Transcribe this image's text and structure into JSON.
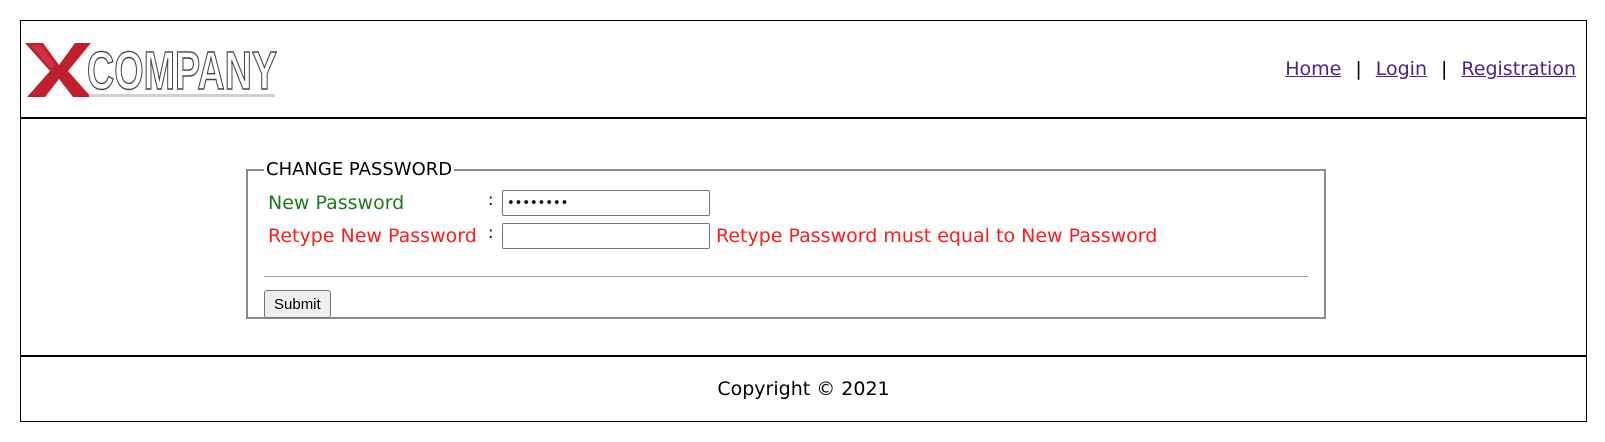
{
  "header": {
    "logo_letter": "X",
    "logo_text": "COMPANY",
    "nav": {
      "home": "Home",
      "separator1": "|",
      "login": "Login",
      "separator2": "|",
      "registration": "Registration"
    }
  },
  "form": {
    "legend": "CHANGE PASSWORD",
    "new_password": {
      "label": "New Password",
      "colon": ":",
      "value": "abcdefgh"
    },
    "retype_password": {
      "label": "Retype New Password",
      "colon": ":",
      "value": "",
      "error": "Retype Password must equal to New Password"
    },
    "submit_label": "Submit"
  },
  "footer": {
    "copyright": "Copyright © 2021"
  },
  "colors": {
    "valid_label": "#1e7a1e",
    "error": "#ff1a1a",
    "link": "#4b1f8c",
    "logo_red": "#c0202e"
  }
}
